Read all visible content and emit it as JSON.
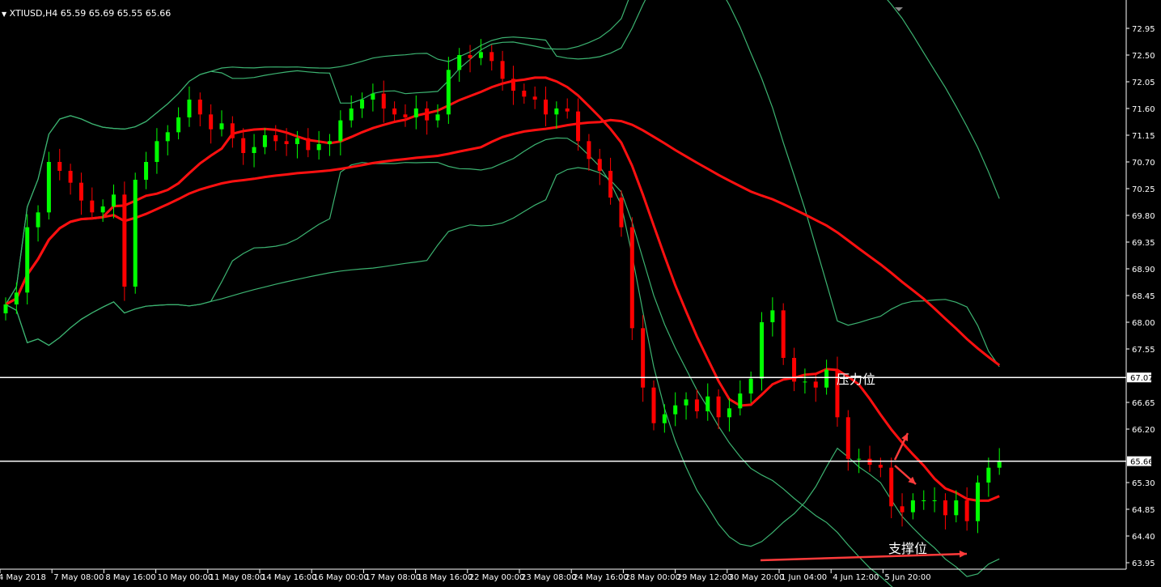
{
  "header": {
    "symbol_label": "XTIUSD,H4",
    "ohlc_label": "65.59 65.69 65.55 65.66"
  },
  "annotations": {
    "resistance_label": "压力位",
    "support_label": "支撑位"
  },
  "colors": {
    "background": "#000000",
    "bull": "#00ff00",
    "bear": "#ff0000",
    "bollinger": "#3cb371",
    "moving_average": "#ff1010",
    "level_line": "#ffffff",
    "arrow": "#ff3b3b"
  },
  "chart_data": {
    "type": "candlestick",
    "symbol": "XTIUSD",
    "timeframe": "H4",
    "y_ticks": [
      "72.95",
      "72.50",
      "72.05",
      "71.60",
      "71.15",
      "70.70",
      "70.25",
      "69.80",
      "69.35",
      "68.90",
      "68.45",
      "68.00",
      "67.55",
      "66.65",
      "66.20",
      "65.30",
      "64.85",
      "64.40",
      "63.95"
    ],
    "x_ticks": [
      "4 May 2018",
      "7 May 08:00",
      "8 May 16:00",
      "10 May 00:00",
      "11 May 08:00",
      "14 May 16:00",
      "16 May 00:00",
      "17 May 08:00",
      "18 May 16:00",
      "22 May 00:00",
      "23 May 08:00",
      "24 May 16:00",
      "28 May 00:00",
      "29 May 12:00",
      "30 May 20:00",
      "1 Jun 04:00",
      "4 Jun 12:00",
      "5 Jun 20:00"
    ],
    "levels": [
      {
        "name": "resistance",
        "value": 67.07,
        "label": "67.07"
      },
      {
        "name": "current",
        "value": 65.66,
        "label": "65.66"
      }
    ],
    "closes": [
      68.3,
      68.5,
      69.6,
      69.85,
      70.7,
      70.55,
      70.35,
      70.05,
      69.85,
      69.95,
      70.15,
      68.6,
      70.4,
      70.7,
      71.05,
      71.2,
      71.45,
      71.75,
      71.5,
      71.25,
      71.35,
      71.1,
      70.85,
      70.95,
      71.15,
      71.05,
      71.0,
      71.1,
      70.9,
      71.0,
      71.05,
      71.4,
      71.6,
      71.75,
      71.85,
      71.6,
      71.5,
      71.45,
      71.6,
      71.4,
      71.5,
      72.25,
      72.5,
      72.45,
      72.55,
      72.4,
      72.1,
      71.9,
      71.8,
      71.75,
      71.5,
      71.6,
      71.55,
      71.05,
      70.75,
      70.55,
      70.1,
      69.6,
      67.9,
      66.9,
      66.3,
      66.45,
      66.6,
      66.7,
      66.5,
      66.75,
      66.4,
      66.55,
      66.8,
      67.05,
      68.0,
      68.2,
      67.4,
      67.0,
      67.0,
      66.9,
      67.2,
      66.4,
      65.7,
      65.7,
      65.6,
      65.55,
      64.9,
      64.8,
      65.0,
      65.0,
      65.0,
      64.75,
      65.0,
      64.65,
      65.3,
      65.55,
      65.66
    ]
  }
}
